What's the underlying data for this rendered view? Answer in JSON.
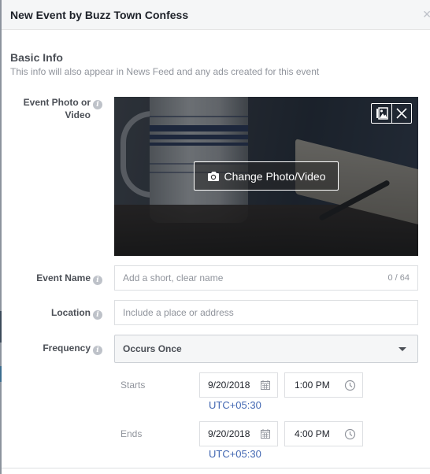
{
  "dialog": {
    "title": "New Event by Buzz Town Confess",
    "close_icon": "close-icon"
  },
  "basic_info": {
    "title": "Basic Info",
    "subtitle": "This info will also appear in News Feed and any ads created for this event"
  },
  "photo": {
    "label_line1": "Event Photo or",
    "label_line2": "Video",
    "change_label": "Change Photo/Video",
    "tools": [
      "image-library-icon",
      "remove-icon"
    ]
  },
  "event_name": {
    "label": "Event Name",
    "placeholder": "Add a short, clear name",
    "value": "",
    "counter": "0 / 64"
  },
  "location": {
    "label": "Location",
    "placeholder": "Include a place or address",
    "value": ""
  },
  "frequency": {
    "label": "Frequency",
    "selected": "Occurs Once"
  },
  "schedule": {
    "starts": {
      "label": "Starts",
      "date": "9/20/2018",
      "time": "1:00 PM",
      "timezone": "UTC+05:30"
    },
    "ends": {
      "label": "Ends",
      "date": "9/20/2018",
      "time": "4:00 PM",
      "timezone": "UTC+05:30"
    }
  },
  "colors": {
    "link": "#4267b2",
    "header_bg": "#f5f6f7",
    "label": "#4b4f56",
    "muted": "#90949c"
  }
}
